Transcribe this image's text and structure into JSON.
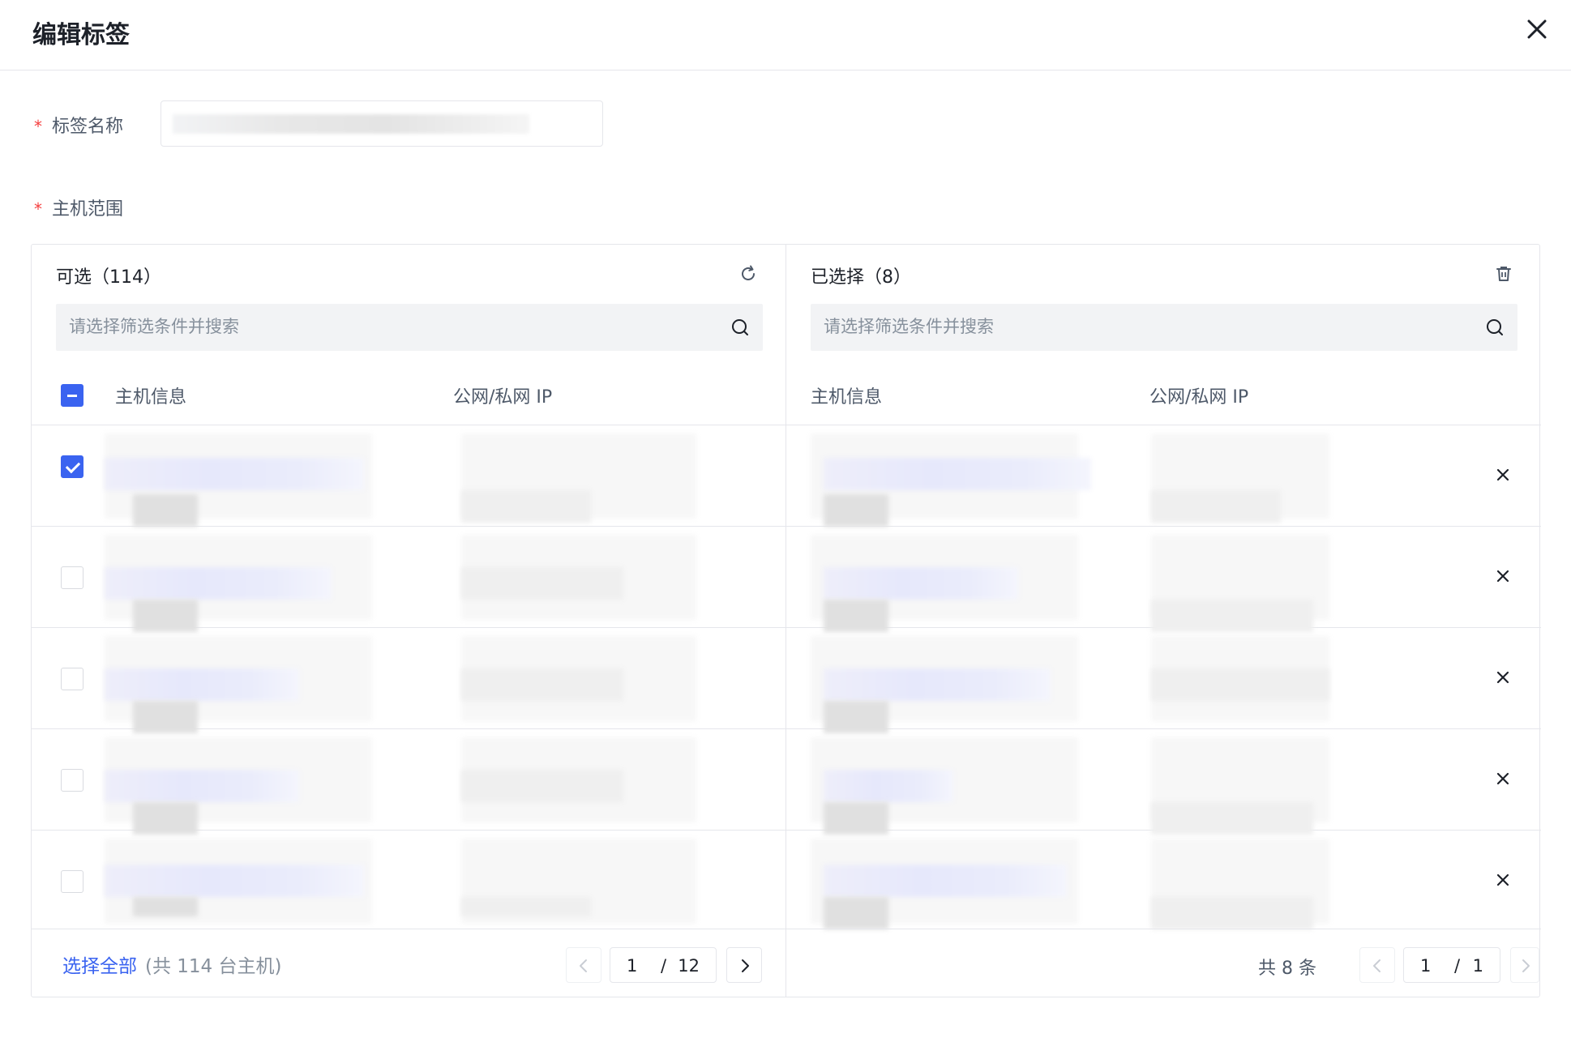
{
  "dialog": {
    "title": "编辑标签",
    "name_label": "标签名称",
    "scope_label": "主机范围",
    "required_mark": "*"
  },
  "left_panel": {
    "title": "可选（114）",
    "search_placeholder": "请选择筛选条件并搜索",
    "col_host": "主机信息",
    "col_ip": "公网/私网 IP",
    "rows": [
      {
        "checked": true
      },
      {
        "checked": false
      },
      {
        "checked": false
      },
      {
        "checked": false
      },
      {
        "checked": false
      }
    ],
    "select_all_label": "选择全部",
    "total_hosts_label": "(共 114 台主机)",
    "pagination": {
      "current": "1",
      "separator": "/",
      "total": "12"
    }
  },
  "right_panel": {
    "title": "已选择（8）",
    "search_placeholder": "请选择筛选条件并搜索",
    "col_host": "主机信息",
    "col_ip": "公网/私网 IP",
    "rows_count": 5,
    "total_label": "共 8 条",
    "pagination": {
      "current": "1",
      "separator": "/",
      "total": "1"
    }
  },
  "colors": {
    "accent": "#3a63f0",
    "required": "#f53f3f",
    "border": "#e5e6eb",
    "search_bg": "#f2f3f5"
  },
  "icons": [
    "close-icon",
    "refresh-icon",
    "trash-icon",
    "search-icon",
    "remove-icon",
    "chevron-left-icon",
    "chevron-right-icon"
  ]
}
